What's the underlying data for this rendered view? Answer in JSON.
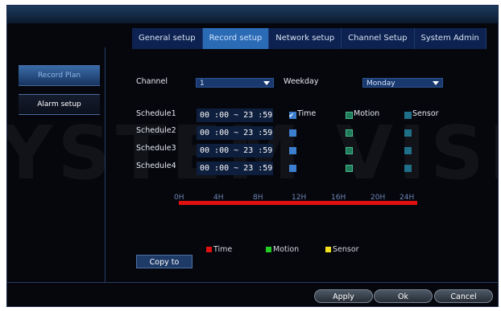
{
  "watermark": "YSTEM VISIO",
  "tabs": [
    "General setup",
    "Record setup",
    "Network setup",
    "Channel Setup",
    "System Admin"
  ],
  "active_tab_index": 1,
  "sidebar": {
    "items": [
      "Record Plan",
      "Alarm setup"
    ]
  },
  "form": {
    "channel_label": "Channel",
    "channel_value": "1",
    "weekday_label": "Weekday",
    "weekday_value": "Monday"
  },
  "schedules": [
    {
      "label": "Schedule1",
      "time": "00 :00  ~  23 :59",
      "time_checked": true
    },
    {
      "label": "Schedule2",
      "time": "00 :00  ~  23 :59",
      "time_checked": false
    },
    {
      "label": "Schedule3",
      "time": "00 :00  ~  23 :59",
      "time_checked": false
    },
    {
      "label": "Schedule4",
      "time": "00 :00  ~  23 :59",
      "time_checked": false
    }
  ],
  "checkbox_labels": {
    "time": "Time",
    "motion": "Motion",
    "sensor": "Sensor"
  },
  "timeline_ticks": [
    "0H",
    "4H",
    "8H",
    "12H",
    "16H",
    "20H",
    "24H"
  ],
  "legend": [
    {
      "label": "Time",
      "color": "#e01010"
    },
    {
      "label": "Motion",
      "color": "#22cc22"
    },
    {
      "label": "Sensor",
      "color": "#f0e020"
    }
  ],
  "buttons": {
    "copy": "Copy to",
    "apply": "Apply",
    "ok": "Ok",
    "cancel": "Cancel"
  }
}
